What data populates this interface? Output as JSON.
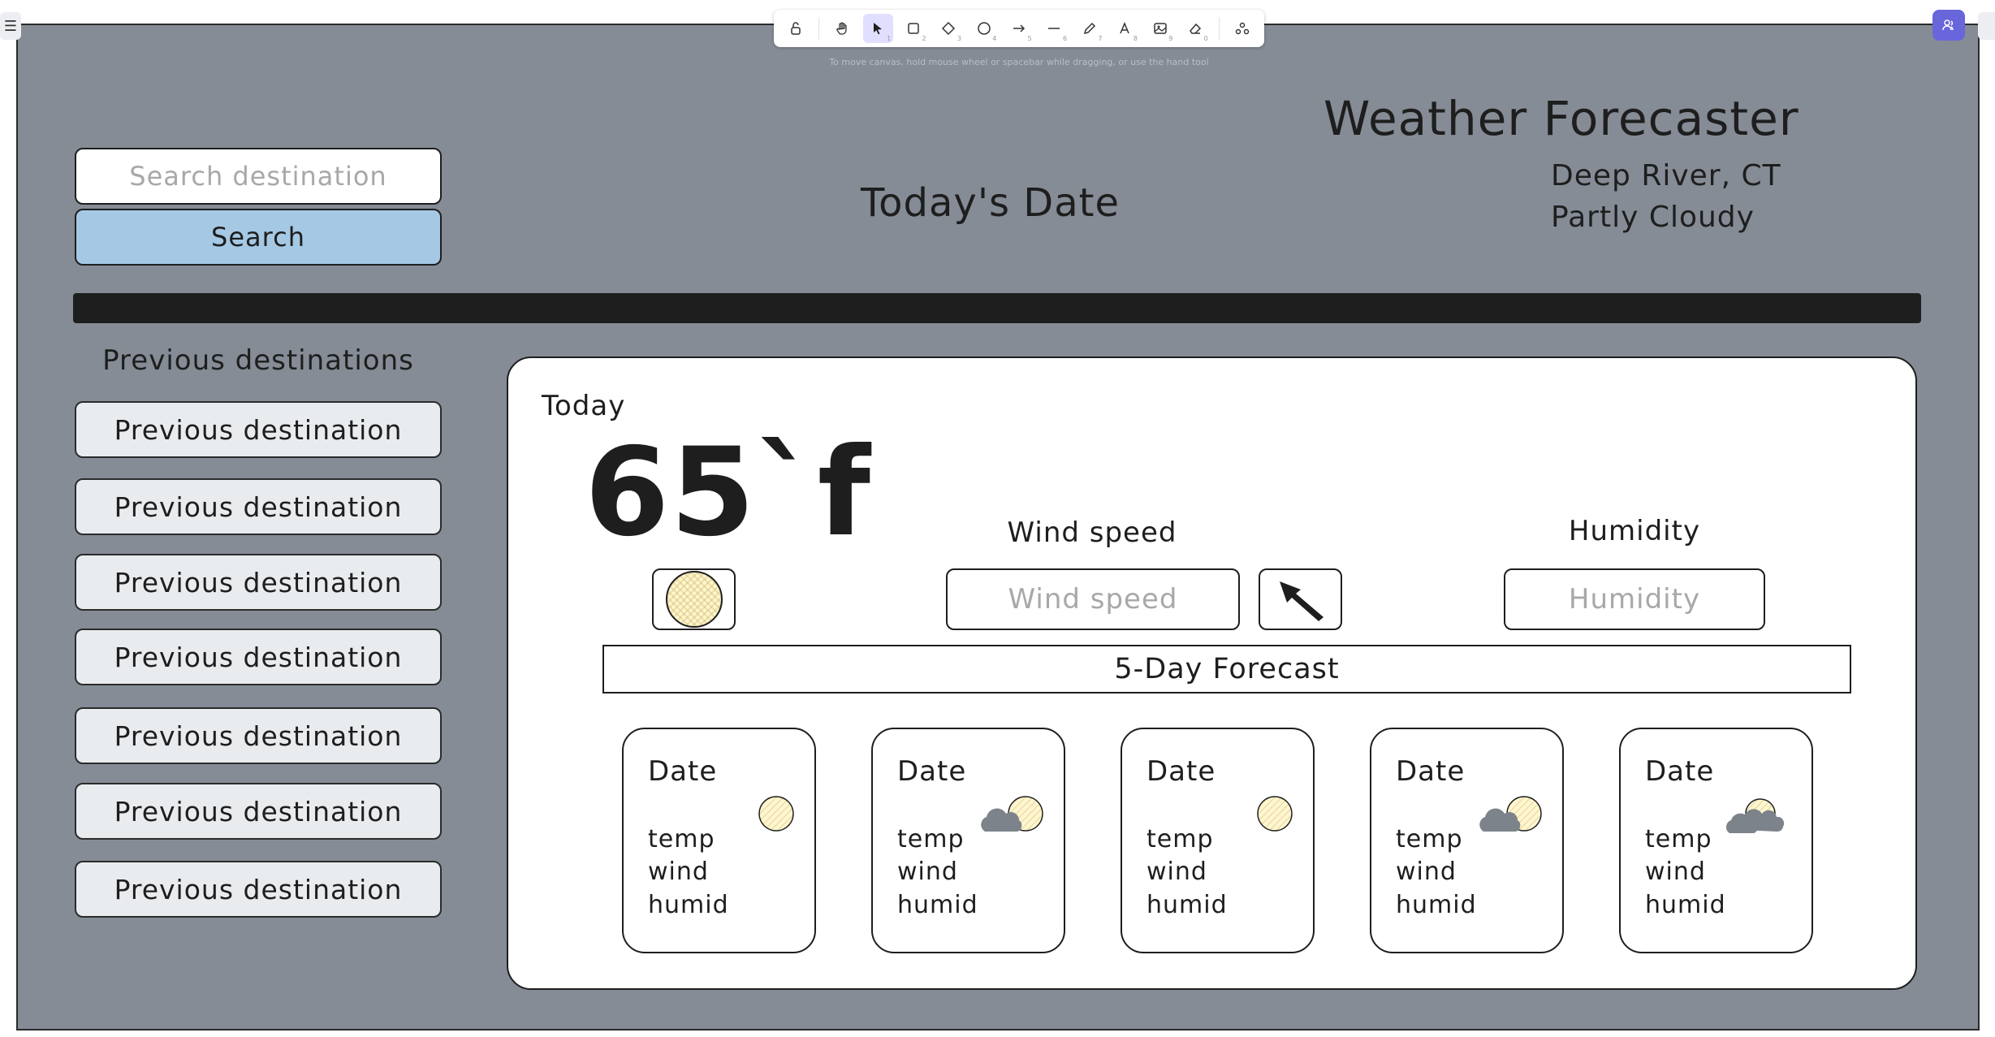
{
  "toolbar": {
    "tools": [
      {
        "name": "lock",
        "num": ""
      },
      {
        "name": "hand",
        "num": ""
      },
      {
        "name": "selection",
        "num": "1"
      },
      {
        "name": "rectangle",
        "num": "2"
      },
      {
        "name": "diamond",
        "num": "3"
      },
      {
        "name": "ellipse",
        "num": "4"
      },
      {
        "name": "arrow",
        "num": "5"
      },
      {
        "name": "line",
        "num": "6"
      },
      {
        "name": "draw",
        "num": "7"
      },
      {
        "name": "text",
        "num": "8"
      },
      {
        "name": "image",
        "num": "9"
      },
      {
        "name": "eraser",
        "num": "0"
      },
      {
        "name": "extra-tools",
        "num": ""
      }
    ],
    "hint": "To move canvas, hold mouse wheel or spacebar while dragging, or use the hand tool"
  },
  "header": {
    "app_title": "Weather Forecaster",
    "location": "Deep River, CT",
    "condition": "Partly Cloudy",
    "date_title": "Today's Date"
  },
  "search": {
    "placeholder": "Search destination",
    "button_label": "Search"
  },
  "previous": {
    "title": "Previous destinations",
    "items": [
      "Previous destination",
      "Previous destination",
      "Previous destination",
      "Previous destination",
      "Previous destination",
      "Previous destination",
      "Previous destination"
    ]
  },
  "today": {
    "label": "Today",
    "temperature": "65`f",
    "wind_label": "Wind speed",
    "wind_placeholder": "Wind speed",
    "humidity_label": "Humidity",
    "humidity_placeholder": "Humidity",
    "icon": "sun-icon"
  },
  "forecast": {
    "title": "5-Day Forecast",
    "days": [
      {
        "date": "Date",
        "temp": "temp",
        "wind": "wind",
        "humid": "humid",
        "icon": "sun"
      },
      {
        "date": "Date",
        "temp": "temp",
        "wind": "wind",
        "humid": "humid",
        "icon": "partly-cloudy"
      },
      {
        "date": "Date",
        "temp": "temp",
        "wind": "wind",
        "humid": "humid",
        "icon": "sun"
      },
      {
        "date": "Date",
        "temp": "temp",
        "wind": "wind",
        "humid": "humid",
        "icon": "partly-cloudy"
      },
      {
        "date": "Date",
        "temp": "temp",
        "wind": "wind",
        "humid": "humid",
        "icon": "cloudy"
      }
    ]
  },
  "colors": {
    "canvas_bg": "#858c96",
    "search_button": "#a5c8e4",
    "previous_item": "#e9ecef",
    "sun_fill": "#fff6cf",
    "cloud_fill": "#7d838a",
    "toolbar_active": "#e0dfff",
    "collab_button": "#6965db"
  }
}
